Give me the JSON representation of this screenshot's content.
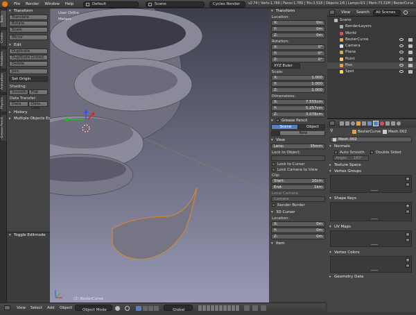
{
  "topbar": {
    "menus": [
      "File",
      "Render",
      "Window",
      "Help"
    ],
    "screen": "Default",
    "scene": "Scene",
    "engine": "Cycles Render",
    "stats": "v2.74 | Verts:1,766 | Faces:1,789 | Tris:3,518 | Objects:1/6 | Lamps:0/1 | Mem:73.31M | BezierCurve"
  },
  "left_tabs": [
    "Tools",
    "Create",
    "Relations",
    "Animation",
    "Physics",
    "Grease Pencil"
  ],
  "tool": {
    "transform_header": "Transform",
    "translate": "Translate",
    "rotate": "Rotate",
    "scale": "Scale",
    "mirror": "Mirror",
    "edit_header": "Edit",
    "duplicate": "Duplicate",
    "duplicate_linked": "Duplicate Linked",
    "delete": "Delete",
    "join": "Join",
    "set_origin": "Set Origin",
    "shading_label": "Shading:",
    "smooth": "Smooth",
    "flat": "Flat",
    "data_transfer_label": "Data Transfer:",
    "data": "Data",
    "data_lays": "Data Lays",
    "history": "History",
    "multiple_objects": "Multiple Objects Edit",
    "toggle_editmode": "Toggle Editmode"
  },
  "viewport": {
    "view_name": "User Ortho",
    "units": "Meters",
    "object_label": "(1) BezierCurve"
  },
  "viewport_bar": {
    "view": "View",
    "select": "Select",
    "add": "Add",
    "object": "Object",
    "mode": "Object Mode",
    "orientation": "Global"
  },
  "properties_panel": {
    "transform_header": "Transform",
    "location_label": "Location:",
    "loc": [
      [
        "X:",
        "0m"
      ],
      [
        "Y:",
        "0m"
      ],
      [
        "Z:",
        "0m"
      ]
    ],
    "rotation_label": "Rotation:",
    "rot": [
      [
        "X:",
        "0°"
      ],
      [
        "Y:",
        "0°"
      ],
      [
        "Z:",
        "0°"
      ]
    ],
    "rotation_mode": "XYZ Euler",
    "scale_label": "Scale:",
    "scale": [
      [
        "X:",
        "1.000"
      ],
      [
        "Y:",
        "1.000"
      ],
      [
        "Z:",
        "1.000"
      ]
    ],
    "dimensions_label": "Dimensions:",
    "dim": [
      [
        "X:",
        "7.555cm"
      ],
      [
        "Y:",
        "5.257cm"
      ],
      [
        "Z:",
        "3.078cm"
      ]
    ],
    "grease_header": "Grease Pencil",
    "gp_scene": "Scene",
    "gp_object": "Object",
    "gp_new": "New",
    "view_header": "View",
    "lens_label": "Lens:",
    "lens": "35mm",
    "lock_object_label": "Lock to Object:",
    "lock_cursor": "Lock to Cursor",
    "lock_camera": "Lock Camera to View",
    "clip_label": "Clip:",
    "clip_start_label": "Start:",
    "clip_start": "10cm",
    "clip_end_label": "End:",
    "clip_end": "1km",
    "local_camera_label": "Local Camera:",
    "local_camera": "Camera",
    "render_border": "Render Border",
    "cursor_header": "3D Cursor",
    "cursor_location_label": "Location:",
    "cur": [
      [
        "X:",
        "0m"
      ],
      [
        "Y:",
        "0m"
      ],
      [
        "Z:",
        "0m"
      ]
    ],
    "item_header": "Item"
  },
  "outliner": {
    "view": "View",
    "search": "Search",
    "scenes": "All Scenes",
    "items": [
      "Scene",
      "RenderLayers",
      "World",
      "BezierCurve",
      "Camera",
      "Plane",
      "Point",
      "Poo",
      "Spot"
    ]
  },
  "properties_editor": {
    "object_name": "BezierCurve",
    "mesh_name": "Mesh.002",
    "mesh_field": "Mesh.002",
    "normals_header": "Normals",
    "auto_smooth": "Auto Smooth",
    "double_sided": "Double Sided",
    "angle_label": "Angle:",
    "angle_value": "180°",
    "texture_space": "Texture Space",
    "vertex_groups": "Vertex Groups",
    "shape_keys": "Shape Keys",
    "uv_maps": "UV Maps",
    "vertex_colors": "Vertex Colors",
    "geometry_data": "Geometry Data"
  }
}
